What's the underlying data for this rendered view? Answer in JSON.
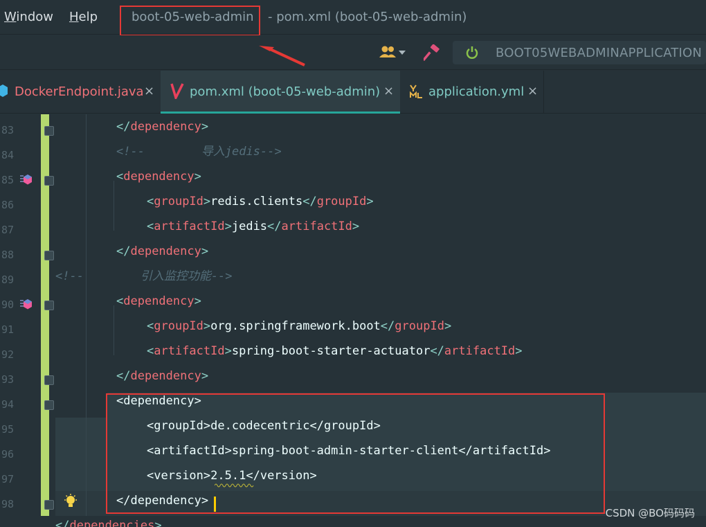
{
  "menubar": {
    "window": {
      "mnemonic": "W",
      "rest": "indow"
    },
    "help": {
      "mnemonic": "H",
      "rest": "elp"
    },
    "title_project": "boot-05-web-admin",
    "title_rest": "- pom.xml (boot-05-web-admin)"
  },
  "toolbar": {
    "run_config": "BOOT05WEBADMINAPPLICATION",
    "icons": [
      "user-group-icon",
      "build-hammer-icon",
      "power-icon"
    ]
  },
  "tabs": [
    {
      "label": "DockerEndpoint.java",
      "icon": "java-class-icon",
      "color": "#f07178",
      "active": false
    },
    {
      "label": "pom.xml (boot-05-web-admin)",
      "icon": "maven-icon",
      "color": "#80cbc4",
      "active": true
    },
    {
      "label": "application.yml",
      "icon": "yaml-icon",
      "color": "#80cbc4",
      "active": false
    }
  ],
  "close_glyph": "×",
  "editor": {
    "lines": [
      {
        "num": "83",
        "indent": 1,
        "kind": "tag-close",
        "name": "dependency"
      },
      {
        "num": "84",
        "indent": 1,
        "kind": "comment",
        "text": "<!--        导入jedis-->"
      },
      {
        "num": "85",
        "indent": 1,
        "kind": "tag-open",
        "name": "dependency"
      },
      {
        "num": "86",
        "indent": 2,
        "kind": "element",
        "name": "groupId",
        "value": "redis.clients"
      },
      {
        "num": "87",
        "indent": 2,
        "kind": "element",
        "name": "artifactId",
        "value": "jedis"
      },
      {
        "num": "88",
        "indent": 1,
        "kind": "tag-close",
        "name": "dependency"
      },
      {
        "num": "89",
        "indent": 0,
        "kind": "comment",
        "text": "<!--        引入监控功能-->"
      },
      {
        "num": "90",
        "indent": 1,
        "kind": "tag-open",
        "name": "dependency"
      },
      {
        "num": "91",
        "indent": 2,
        "kind": "element",
        "name": "groupId",
        "value": "org.springframework.boot"
      },
      {
        "num": "92",
        "indent": 2,
        "kind": "element",
        "name": "artifactId",
        "value": "spring-boot-starter-actuator"
      },
      {
        "num": "93",
        "indent": 1,
        "kind": "tag-close",
        "name": "dependency"
      },
      {
        "num": "94",
        "indent": 1,
        "kind": "tag-open",
        "name": "dependency",
        "plain": true
      },
      {
        "num": "95",
        "indent": 2,
        "kind": "element",
        "name": "groupId",
        "value": "de.codecentric",
        "plain": true
      },
      {
        "num": "96",
        "indent": 2,
        "kind": "element",
        "name": "artifactId",
        "value": "spring-boot-admin-starter-client",
        "plain": true
      },
      {
        "num": "97",
        "indent": 2,
        "kind": "element",
        "name": "version",
        "value": "2.5.1",
        "plain": true
      },
      {
        "num": "98",
        "indent": 1,
        "kind": "tag-close",
        "name": "dependency",
        "plain": true
      },
      {
        "num": "",
        "indent": 0,
        "kind": "tag-close",
        "name": "dependencies"
      }
    ]
  },
  "watermark": "CSDN @BO码码码",
  "colors": {
    "accent": "#26a69a",
    "highlight_box": "#e53935",
    "change_bar": "#b5d96f",
    "caret": "#ffcc00"
  }
}
